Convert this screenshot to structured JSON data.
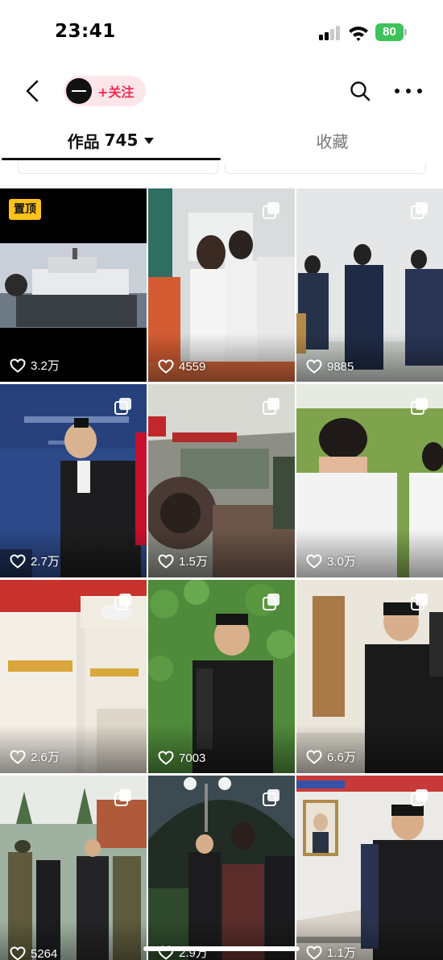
{
  "status_bar": {
    "time": "23:41",
    "battery": "80",
    "battery_color": "#3ec35a"
  },
  "nav": {
    "back_icon": "chevron-left-icon",
    "follow_label": "+关注",
    "follow_color": "#f0294f",
    "search_icon": "search-icon",
    "more_icon": "more-dots-icon"
  },
  "tabs": {
    "works_label": "作品",
    "works_count": "745",
    "favorites_label": "收藏"
  },
  "pinned_label": "置顶",
  "posts": [
    {
      "likes": "3.2万",
      "pinned": true,
      "multi_image": false
    },
    {
      "likes": "4559",
      "pinned": false,
      "multi_image": true
    },
    {
      "likes": "9885",
      "pinned": false,
      "multi_image": true
    },
    {
      "likes": "2.7万",
      "pinned": false,
      "multi_image": true
    },
    {
      "likes": "1.5万",
      "pinned": false,
      "multi_image": true
    },
    {
      "likes": "3.0万",
      "pinned": false,
      "multi_image": true
    },
    {
      "likes": "2.6万",
      "pinned": false,
      "multi_image": true
    },
    {
      "likes": "7003",
      "pinned": false,
      "multi_image": true
    },
    {
      "likes": "6.6万",
      "pinned": false,
      "multi_image": true
    },
    {
      "likes": "5264",
      "pinned": false,
      "multi_image": true
    },
    {
      "likes": "2.9万",
      "pinned": false,
      "multi_image": true
    },
    {
      "likes": "1.1万",
      "pinned": false,
      "multi_image": true
    }
  ]
}
